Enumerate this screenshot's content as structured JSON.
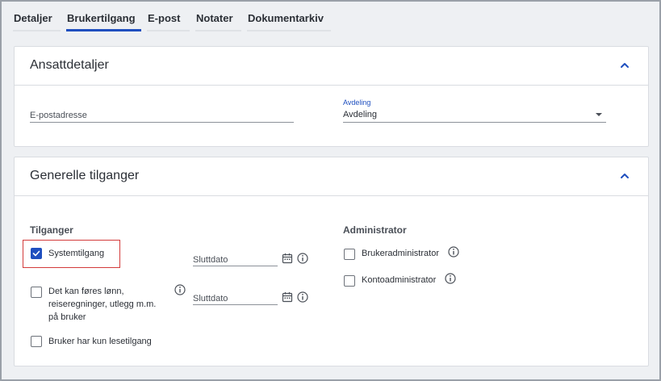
{
  "tabs": [
    {
      "label": "Detaljer",
      "active": false
    },
    {
      "label": "Brukertilgang",
      "active": true
    },
    {
      "label": "E-post",
      "active": false
    },
    {
      "label": "Notater",
      "active": false
    },
    {
      "label": "Dokumentarkiv",
      "active": false
    }
  ],
  "employee_card": {
    "title": "Ansattdetaljer",
    "email": {
      "placeholder": "E-postadresse",
      "value": ""
    },
    "department": {
      "label": "Avdeling",
      "value": "Avdeling"
    }
  },
  "access_card": {
    "title": "Generelle tilganger",
    "access_heading": "Tilganger",
    "admin_heading": "Administrator",
    "system_access": {
      "label": "Systemtilgang",
      "checked": true
    },
    "payroll": {
      "label_line1": "Det kan føres lønn,",
      "label_line2": "reiseregninger, utlegg m.m.",
      "label_line3": "på bruker",
      "checked": false
    },
    "readonly": {
      "label": "Bruker har kun lesetilgang",
      "checked": false
    },
    "end_date_1": {
      "placeholder": "Sluttdato"
    },
    "end_date_2": {
      "placeholder": "Sluttdato"
    },
    "user_admin": {
      "label": "Brukeradministrator",
      "checked": false
    },
    "account_admin": {
      "label": "Kontoadministrator",
      "checked": false
    }
  },
  "colors": {
    "accent": "#1f4fbf",
    "highlight": "#d33b3b"
  }
}
